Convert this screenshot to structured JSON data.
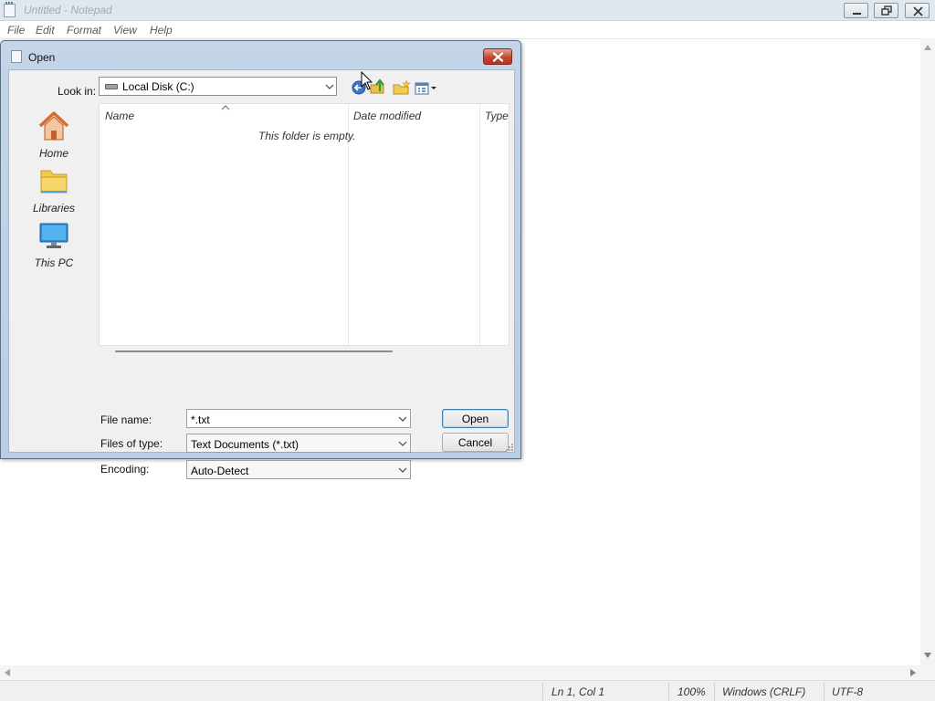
{
  "notepad": {
    "title": "Untitled - Notepad",
    "menu": [
      "File",
      "Edit",
      "Format",
      "View",
      "Help"
    ],
    "status": {
      "position": "Ln 1, Col 1",
      "zoom": "100%",
      "line_endings": "Windows (CRLF)",
      "encoding": "UTF-8"
    }
  },
  "dialog": {
    "title": "Open",
    "look_in": {
      "label": "Look in:",
      "value": "Local Disk (C:)"
    },
    "toolbar_icons": [
      "back-icon",
      "up-folder-icon",
      "new-folder-icon",
      "view-menu-icon"
    ],
    "places": [
      {
        "label": "Home",
        "icon": "home-icon"
      },
      {
        "label": "Libraries",
        "icon": "libraries-folder-icon"
      },
      {
        "label": "This PC",
        "icon": "monitor-icon"
      }
    ],
    "file_list": {
      "columns": [
        "Name",
        "Date modified",
        "Type"
      ],
      "empty_message": "This folder is empty."
    },
    "file_name": {
      "label": "File name:",
      "value": "*.txt"
    },
    "files_of_type": {
      "label": "Files of type:",
      "value": "Text Documents (*.txt)"
    },
    "encoding": {
      "label": "Encoding:",
      "value": "Auto-Detect"
    },
    "buttons": {
      "open": "Open",
      "cancel": "Cancel"
    }
  },
  "colors": {
    "dialog_frame": "#c4d5e8",
    "close_button": "#c8462f",
    "default_button_border": "#3c7fb1"
  }
}
